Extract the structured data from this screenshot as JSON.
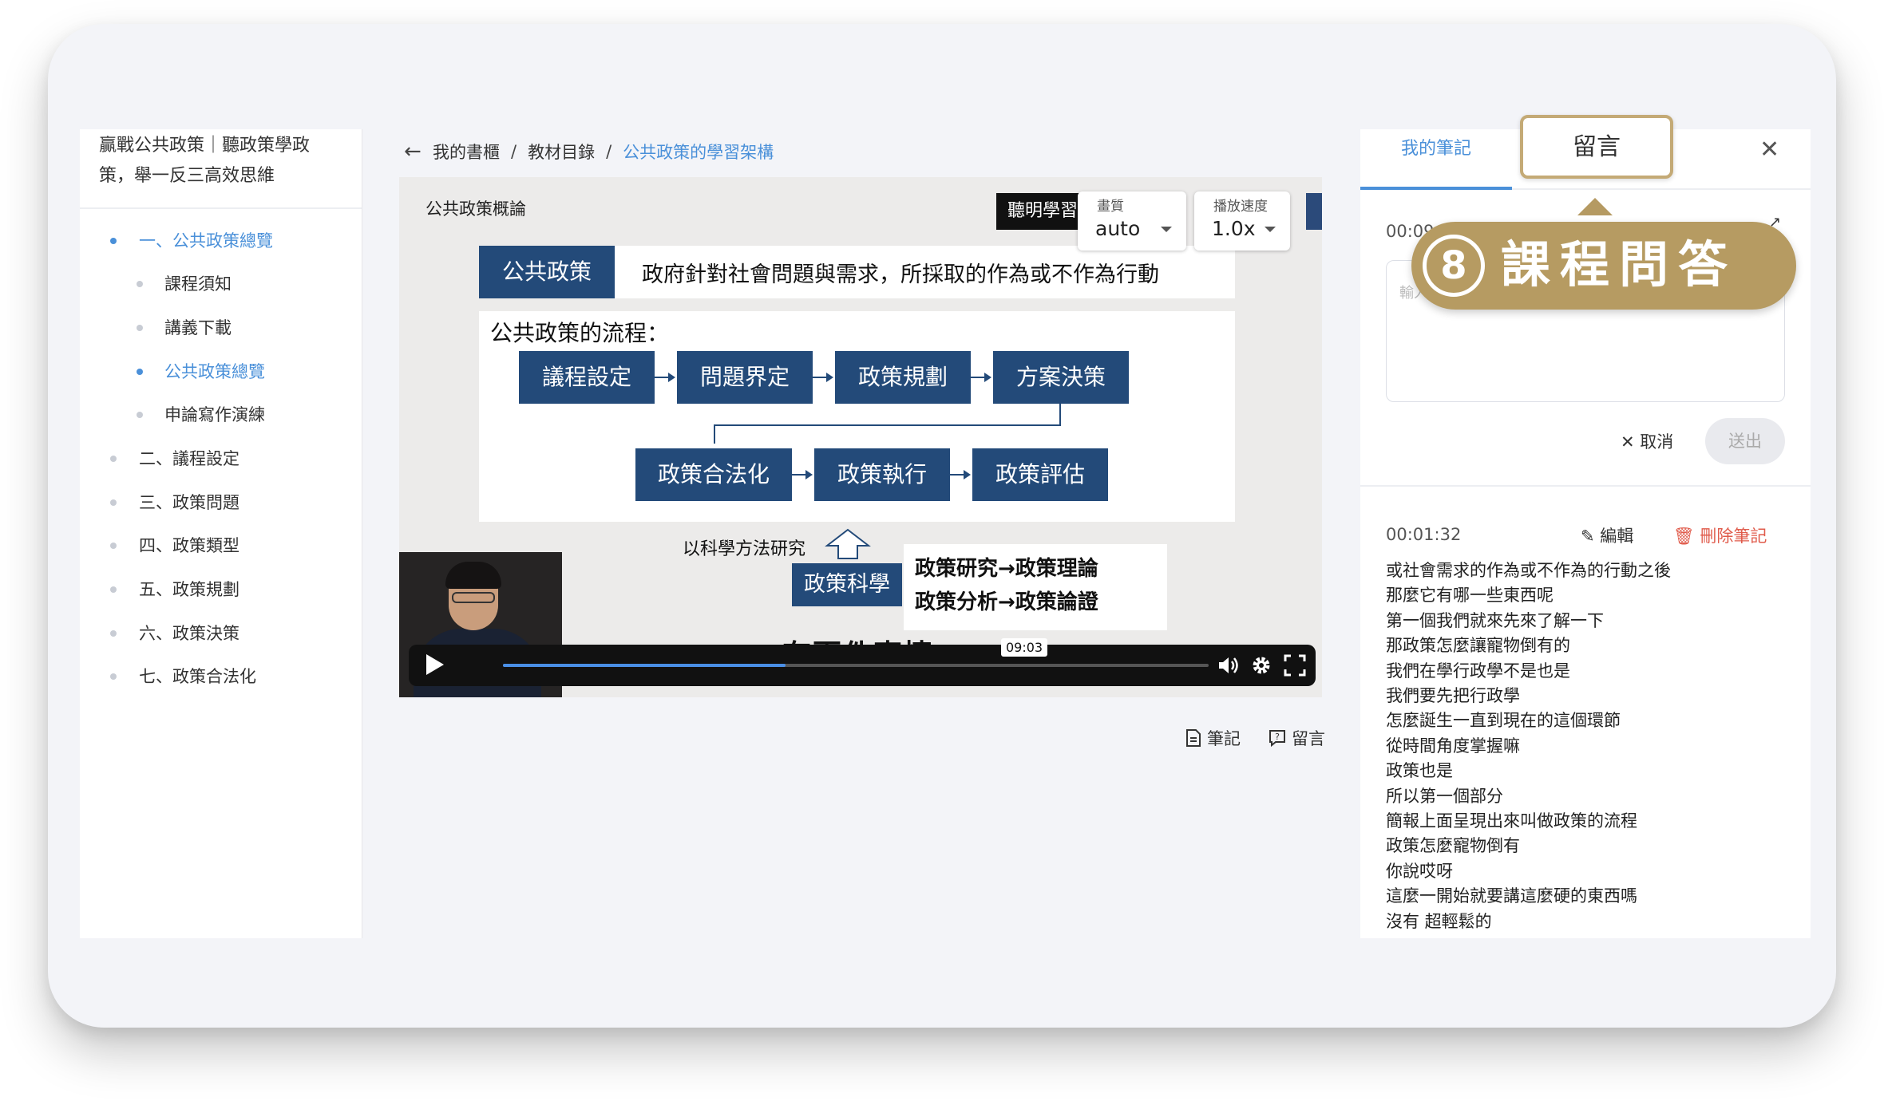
{
  "course_title": "贏戰公共政策｜聽政策學政策，舉一反三高效思維",
  "toc": [
    {
      "label": "一、公共政策總覽",
      "level": 1,
      "active": true
    },
    {
      "label": "課程須知",
      "level": 2,
      "active": false
    },
    {
      "label": "講義下載",
      "level": 2,
      "active": false
    },
    {
      "label": "公共政策總覽",
      "level": 2,
      "active": true
    },
    {
      "label": "申論寫作演練",
      "level": 2,
      "active": false
    },
    {
      "label": "二、議程設定",
      "level": 1,
      "active": false
    },
    {
      "label": "三、政策問題",
      "level": 1,
      "active": false
    },
    {
      "label": "四、政策類型",
      "level": 1,
      "active": false
    },
    {
      "label": "五、政策規劃",
      "level": 1,
      "active": false
    },
    {
      "label": "六、政策決策",
      "level": 1,
      "active": false
    },
    {
      "label": "七、政策合法化",
      "level": 1,
      "active": false
    }
  ],
  "breadcrumb": {
    "back_icon": "arrow-left-icon",
    "items": [
      "我的書櫃",
      "教材目錄",
      "公共政策的學習架構"
    ],
    "separator": "/"
  },
  "video": {
    "slide_heading": "公共政策概論",
    "brand_text": "聽明學習",
    "quality": {
      "label": "畫質",
      "value": "auto"
    },
    "speed": {
      "label": "播放速度",
      "value": "1.0x"
    },
    "definition_key": "公共政策",
    "definition_text": "政府針對社會問題與需求，所採取的作為或不作為行動",
    "flow_title": "公共政策的流程：",
    "flow_steps": [
      "議程設定",
      "問題界定",
      "政策規劃",
      "方案決策",
      "政策合法化",
      "政策執行",
      "政策評估"
    ],
    "method_label": "以科學方法研究",
    "science_label": "政策科學",
    "research_lines": [
      "政策研究→政策理論",
      "政策分析→政策論證"
    ],
    "subtitle": "有兩件事情",
    "time_tooltip": "09:03",
    "progress": 0.4
  },
  "video_actions": {
    "note": "筆記",
    "comment": "留言"
  },
  "panel": {
    "tab_notes": "我的筆記",
    "tab_comments": "留言",
    "note_timestamp": "00:09:03",
    "note_placeholder": "輸入筆記",
    "cancel": "取消",
    "send": "送出",
    "saved_timestamp": "00:01:32",
    "edit": "編輯",
    "delete": "刪除筆記",
    "transcript": [
      "或社會需求的作為或不作為的行動之後",
      "那麼它有哪一些東西呢",
      "第一個我們就來先來了解一下",
      "那政策怎麼讓寵物倒有的",
      "我們在學行政學不是也是",
      "我們要先把行政學",
      "怎麼誕生一直到現在的這個環節",
      "從時間角度掌握嘛",
      "政策也是",
      "所以第一個部分",
      "簡報上面呈現出來叫做政策的流程",
      "政策怎麼寵物倒有",
      "你說哎呀",
      "這麼一開始就要講這麼硬的東西嗎",
      "沒有 超輕鬆的"
    ]
  },
  "badge": {
    "number": "8",
    "label": "課程問答"
  },
  "colors": {
    "accent": "#4a90d9",
    "slide_navy": "#234a79",
    "badge_gold": "#b69b62",
    "danger": "#e05b4b"
  }
}
